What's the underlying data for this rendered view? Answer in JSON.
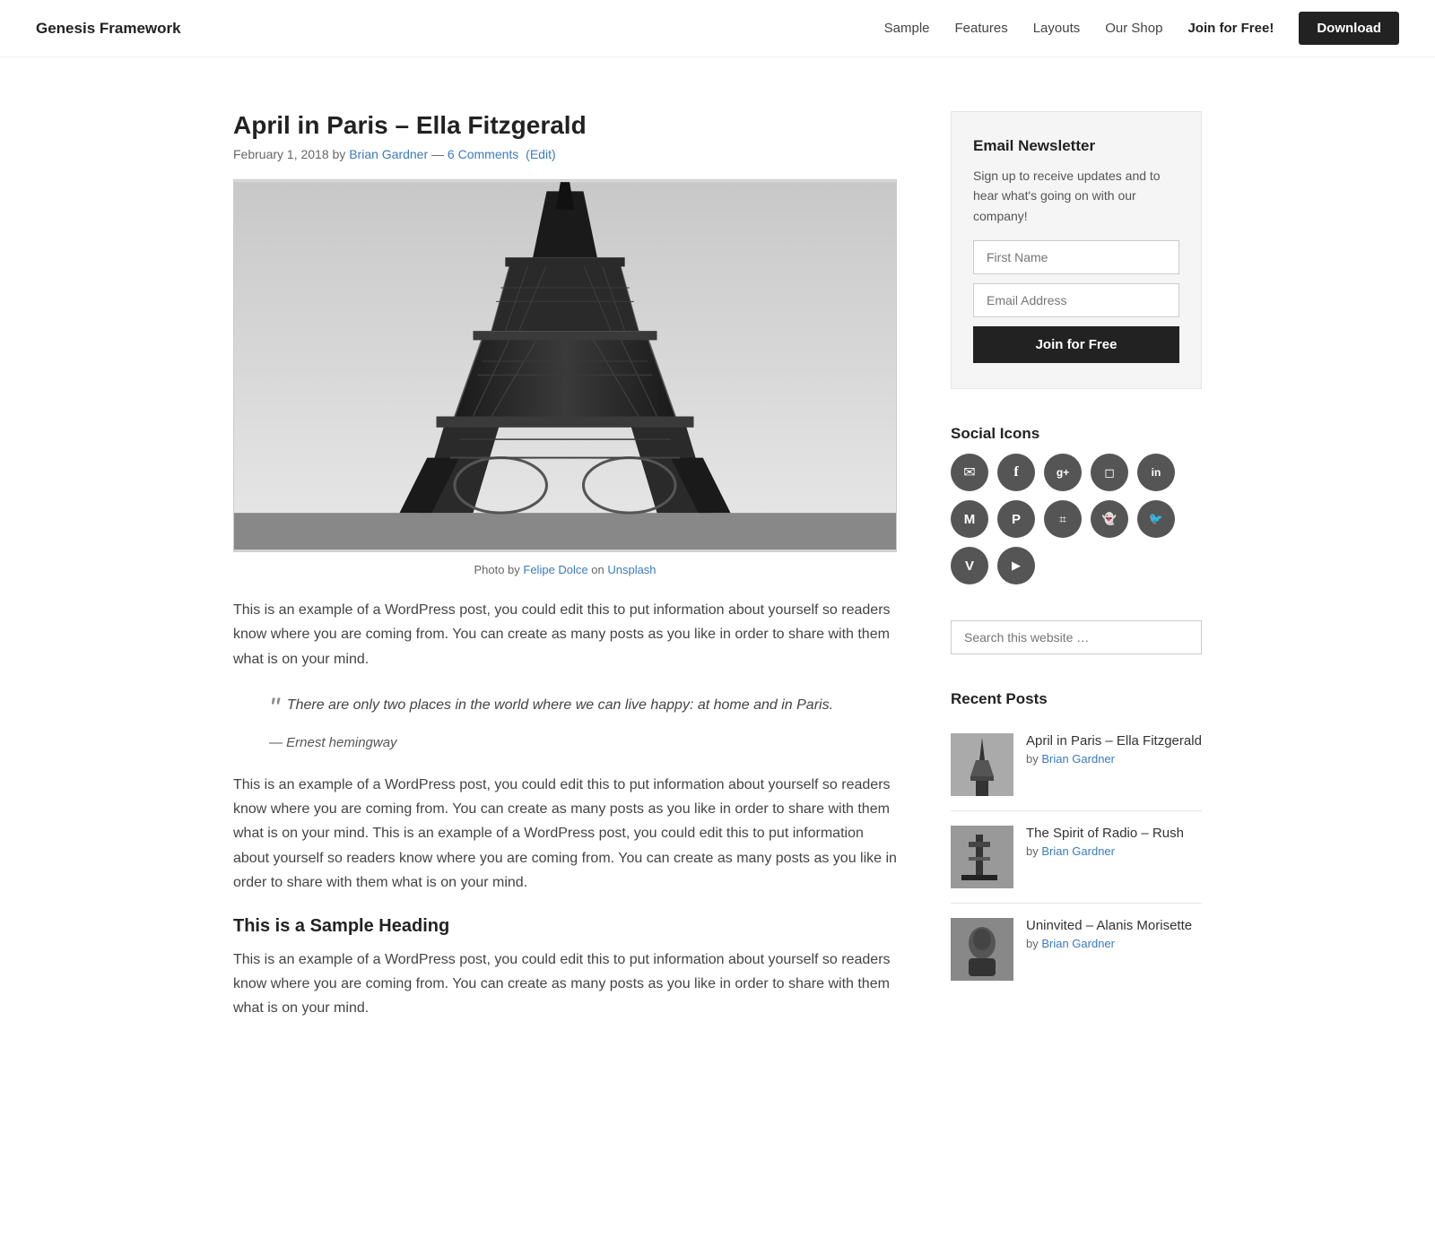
{
  "site": {
    "title": "Genesis Framework"
  },
  "nav": {
    "links": [
      {
        "label": "Sample",
        "href": "#"
      },
      {
        "label": "Features",
        "href": "#"
      },
      {
        "label": "Layouts",
        "href": "#"
      },
      {
        "label": "Our Shop",
        "href": "#"
      },
      {
        "label": "Join for Free!",
        "href": "#",
        "class": "join"
      }
    ],
    "download_label": "Download"
  },
  "post": {
    "title": "April in Paris – Ella Fitzgerald",
    "date": "February 1, 2018",
    "author": "Brian Gardner",
    "comments": "6 Comments",
    "edit": "(Edit)",
    "photo_credit_text": "Photo by ",
    "photo_credit_name": "Felipe Dolce",
    "photo_credit_on": " on ",
    "photo_credit_platform": "Unsplash",
    "body_p1": "This is an example of a WordPress post, you could edit this to put information about yourself so readers know where you are coming from. You can create as many posts as you like in order to share with them what is on your mind.",
    "blockquote_text": "There are only two places in the world where we can live happy: at home and in Paris.",
    "blockquote_cite": "— Ernest hemingway",
    "body_p2": "This is an example of a WordPress post, you could edit this to put information about yourself so readers know where you are coming from. You can create as many posts as you like in order to share with them what is on your mind. This is an example of a WordPress post, you could edit this to put information about yourself so readers know where you are coming from. You can create as many posts as you like in order to share with them what is on your mind.",
    "subheading": "This is a Sample Heading",
    "body_p3": "This is an example of a WordPress post, you could edit this to put information about yourself so readers know where you are coming from. You can create as many posts as you like in order to share with them what is on your mind."
  },
  "sidebar": {
    "newsletter": {
      "title": "Email Newsletter",
      "desc": "Sign up to receive updates and to hear what's going on with our company!",
      "first_name_placeholder": "First Name",
      "email_placeholder": "Email Address",
      "btn_label": "Join for Free"
    },
    "social": {
      "title": "Social Icons",
      "icons": [
        {
          "name": "email-icon",
          "symbol": "✉"
        },
        {
          "name": "facebook-icon",
          "symbol": "f"
        },
        {
          "name": "google-plus-icon",
          "symbol": "g+"
        },
        {
          "name": "instagram-icon",
          "symbol": "📷"
        },
        {
          "name": "linkedin-icon",
          "symbol": "in"
        },
        {
          "name": "medium-icon",
          "symbol": "M"
        },
        {
          "name": "pinterest-icon",
          "symbol": "P"
        },
        {
          "name": "rss-icon",
          "symbol": "⌗"
        },
        {
          "name": "snapchat-icon",
          "symbol": "👻"
        },
        {
          "name": "twitter-icon",
          "symbol": "🐦"
        },
        {
          "name": "vimeo-icon",
          "symbol": "V"
        },
        {
          "name": "youtube-icon",
          "symbol": "▶"
        }
      ]
    },
    "search": {
      "placeholder": "Search this website …"
    },
    "recent_posts": {
      "title": "Recent Posts",
      "items": [
        {
          "title": "April in Paris – Ella Fitzgerald",
          "author": "Brian Gardner"
        },
        {
          "title": "The Spirit of Radio – Rush",
          "author": "Brian Gardner"
        },
        {
          "title": "Uninvited – Alanis Morisette",
          "author": "Brian Gardner"
        }
      ]
    }
  }
}
